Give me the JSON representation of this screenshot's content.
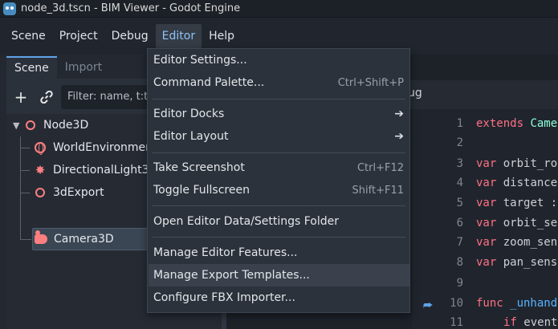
{
  "window": {
    "title": "node_3d.tscn - BIM Viewer - Godot Engine"
  },
  "menubar": {
    "items": [
      {
        "label": "Scene"
      },
      {
        "label": "Project"
      },
      {
        "label": "Debug"
      },
      {
        "label": "Editor",
        "active": true
      },
      {
        "label": "Help"
      }
    ]
  },
  "scene_dock": {
    "tabs": [
      {
        "label": "Scene",
        "active": true
      },
      {
        "label": "Import"
      }
    ],
    "filter_placeholder": "Filter: name, t:t",
    "add_icon": "plus-icon",
    "link_icon": "link-icon",
    "tree": [
      {
        "label": "Node3D",
        "icon": "node3d-icon",
        "expanded": true
      },
      {
        "label": "WorldEnvironment",
        "icon": "world-environment-icon"
      },
      {
        "label": "DirectionalLight3D",
        "icon": "directional-light-icon"
      },
      {
        "label": "3dExport",
        "icon": "node3d-icon"
      },
      {
        "label": "Camera3D",
        "icon": "camera-icon",
        "selected": true
      }
    ]
  },
  "script_panel": {
    "tab_partial": "ug"
  },
  "editor": {
    "lines": [
      {
        "n": "1",
        "kw": "extends",
        "rest": " Came"
      },
      {
        "n": "2",
        "kw": "",
        "rest": ""
      },
      {
        "n": "3",
        "kw": "var",
        "rest": " orbit_ro"
      },
      {
        "n": "4",
        "kw": "var",
        "rest": " distance"
      },
      {
        "n": "5",
        "kw": "var",
        "rest": " target :"
      },
      {
        "n": "6",
        "kw": "var",
        "rest": " orbit_se"
      },
      {
        "n": "7",
        "kw": "var",
        "rest": " zoom_sens"
      },
      {
        "n": "8",
        "kw": "var",
        "rest": " pan_sens"
      },
      {
        "n": "9",
        "kw": "",
        "rest": ""
      },
      {
        "n": "10",
        "kw": "func",
        "rest": " _unhand"
      },
      {
        "n": "11",
        "kw": "if",
        "rest": " event"
      }
    ]
  },
  "editor_menu": {
    "items": [
      {
        "label": "Editor Settings...",
        "shortcut": ""
      },
      {
        "label": "Command Palette...",
        "shortcut": "Ctrl+Shift+P"
      },
      {
        "label": "Editor Docks",
        "submenu": true
      },
      {
        "label": "Editor Layout",
        "submenu": true
      },
      {
        "label": "Take Screenshot",
        "shortcut": "Ctrl+F12"
      },
      {
        "label": "Toggle Fullscreen",
        "shortcut": "Shift+F11"
      },
      {
        "label": "Open Editor Data/Settings Folder",
        "shortcut": ""
      },
      {
        "label": "Manage Editor Features...",
        "shortcut": ""
      },
      {
        "label": "Manage Export Templates...",
        "shortcut": "",
        "hover": true
      },
      {
        "label": "Configure FBX Importer...",
        "shortcut": ""
      }
    ]
  },
  "colors": {
    "accent": "#5ea3e8",
    "node_icon": "#fc7f7f",
    "keyword": "#ff7085",
    "menu_active_text": "#8ec3f5"
  }
}
